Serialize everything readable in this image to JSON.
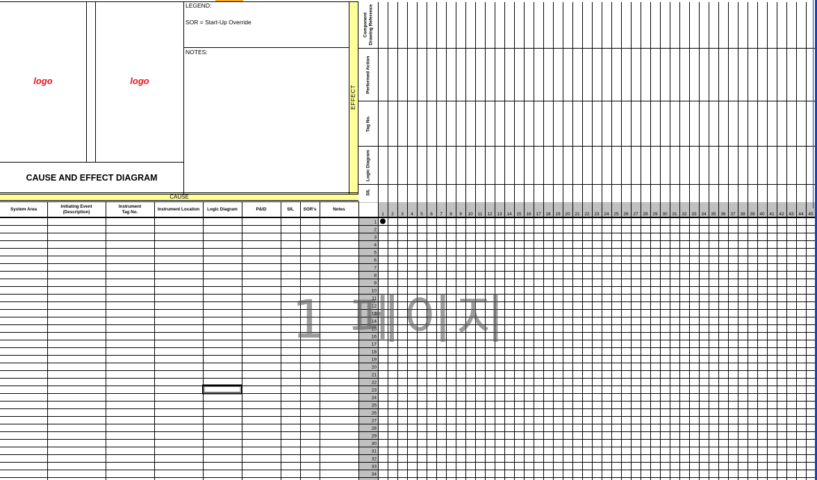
{
  "logos": [
    "logo",
    "logo"
  ],
  "title": "CAUSE AND EFFECT DIAGRAM",
  "legend": {
    "heading": "LEGEND:",
    "item": "SOR = Start-Up Override"
  },
  "notes_heading": "NOTES:",
  "cause_label": "CAUSE",
  "effect_label": "EFFECT",
  "effect_headers": [
    "Component\nDrawing Reference",
    "Performed Action",
    "Tag No.",
    "Logic Diagram",
    "SIL"
  ],
  "cause_columns": [
    "System Area",
    "Initiating Event\n(Description)",
    "Instrument\nTag No.",
    "Instrument Location",
    "Logic Diagram",
    "P&ID",
    "SIL",
    "SOR's",
    "Notes"
  ],
  "effect_column_numbers": [
    "1",
    "2",
    "3",
    "4",
    "5",
    "6",
    "7",
    "8",
    "9",
    "10",
    "11",
    "12",
    "13",
    "14",
    "15",
    "16",
    "17",
    "18",
    "19",
    "20",
    "21",
    "22",
    "23",
    "24",
    "25",
    "26",
    "27",
    "28",
    "29",
    "30",
    "31",
    "32",
    "33",
    "34",
    "35",
    "36",
    "37",
    "38",
    "39",
    "40",
    "41",
    "42",
    "43",
    "44",
    "45"
  ],
  "row_numbers": [
    "1",
    "2",
    "3",
    "4",
    "5",
    "6",
    "7",
    "8",
    "9",
    "10",
    "11",
    "12",
    "13",
    "14",
    "15",
    "16",
    "17",
    "18",
    "19",
    "20",
    "21",
    "22",
    "23",
    "24",
    "25",
    "26",
    "27",
    "28",
    "29",
    "30",
    "31",
    "32",
    "33",
    "34"
  ],
  "watermark": "1 페이지",
  "colors": {
    "header_yellow": "#ffff99",
    "row_number_gray": "#c0c0c0",
    "logo_red": "#e8141c",
    "frame_blue": "#1f3fb6"
  }
}
